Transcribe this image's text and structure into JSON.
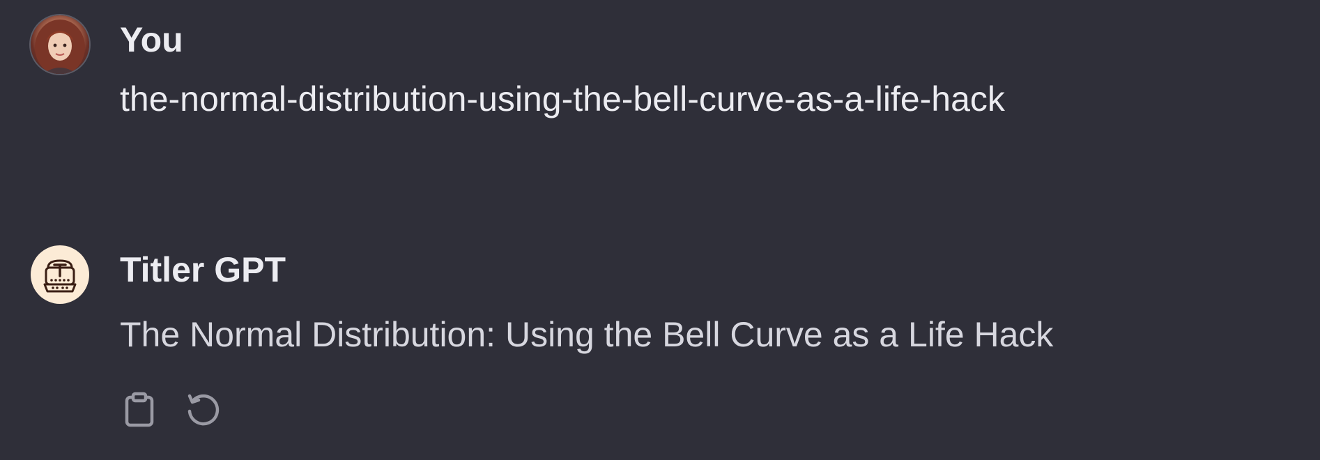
{
  "messages": [
    {
      "role": "user",
      "author": "You",
      "text": "the-normal-distribution-using-the-bell-curve-as-a-life-hack",
      "avatar_icon": "user-portrait-avatar"
    },
    {
      "role": "assistant",
      "author": "Titler GPT",
      "text": "The Normal Distribution: Using the Bell Curve as a Life Hack",
      "avatar_icon": "typewriter-icon",
      "actions": [
        {
          "icon": "clipboard-icon",
          "label": "Copy"
        },
        {
          "icon": "regenerate-icon",
          "label": "Regenerate"
        }
      ]
    }
  ],
  "colors": {
    "background": "#2f2f39",
    "author_text": "#ececf1",
    "message_text": "#d7d7df",
    "icon_gray": "#9a9aa4",
    "bot_avatar_bg": "#fcebd6",
    "bot_avatar_icon": "#3a1e14"
  }
}
